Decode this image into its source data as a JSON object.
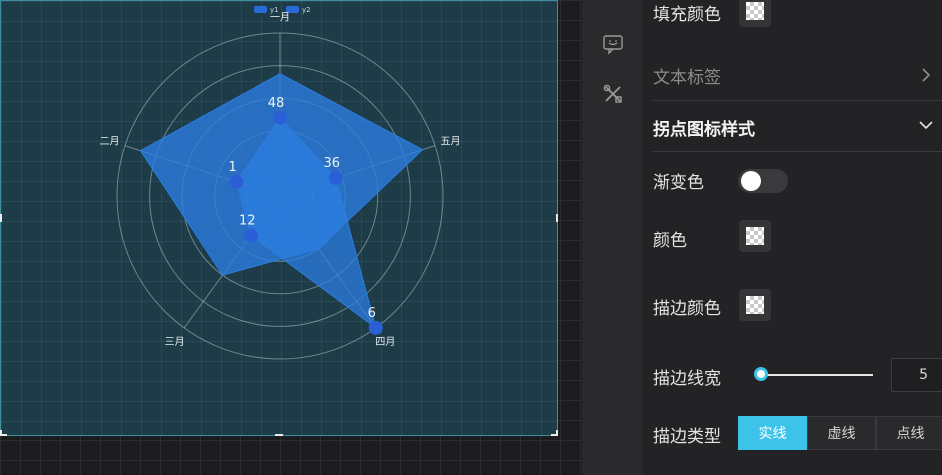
{
  "chart_data": {
    "type": "radar",
    "legend": {
      "position": "top-center",
      "entries": [
        {
          "name": "y1",
          "color": "#2a6ad8"
        },
        {
          "name": "y2",
          "color": "#2a6ad8"
        }
      ]
    },
    "indicators": [
      "一月",
      "五月",
      "四月",
      "三月",
      "二月"
    ],
    "max": 100,
    "series": [
      {
        "name": "y1",
        "values": [
          75,
          92,
          40,
          60,
          90
        ],
        "show_labels": false
      },
      {
        "name": "y2",
        "values": [
          48,
          36,
          6,
          12,
          1
        ],
        "labels": [
          "48",
          "36",
          "6",
          "12",
          "1"
        ],
        "marker_values": [
          48,
          36,
          100,
          30,
          28
        ]
      }
    ],
    "rings": 5,
    "colors": {
      "area": "#2b7de0",
      "marker": "#2b5fd8"
    }
  },
  "panel": {
    "fill_color_label": "填充颜色",
    "text_label_section": "文本标签",
    "marker_style_section": "拐点图标样式",
    "gradient_label": "渐变色",
    "color_label": "颜色",
    "stroke_color_label": "描边颜色",
    "stroke_width_label": "描边线宽",
    "stroke_width_value": "5",
    "stroke_width_fraction": 0.05,
    "stroke_type_label": "描边类型",
    "stroke_types": [
      "实线",
      "虚线",
      "点线"
    ],
    "active_stroke_type": "实线",
    "gradient_on": false
  },
  "icons": {
    "comment": "comment-icon",
    "tools": "tools-icon"
  },
  "theme": {
    "accent": "#3dc3ea"
  }
}
